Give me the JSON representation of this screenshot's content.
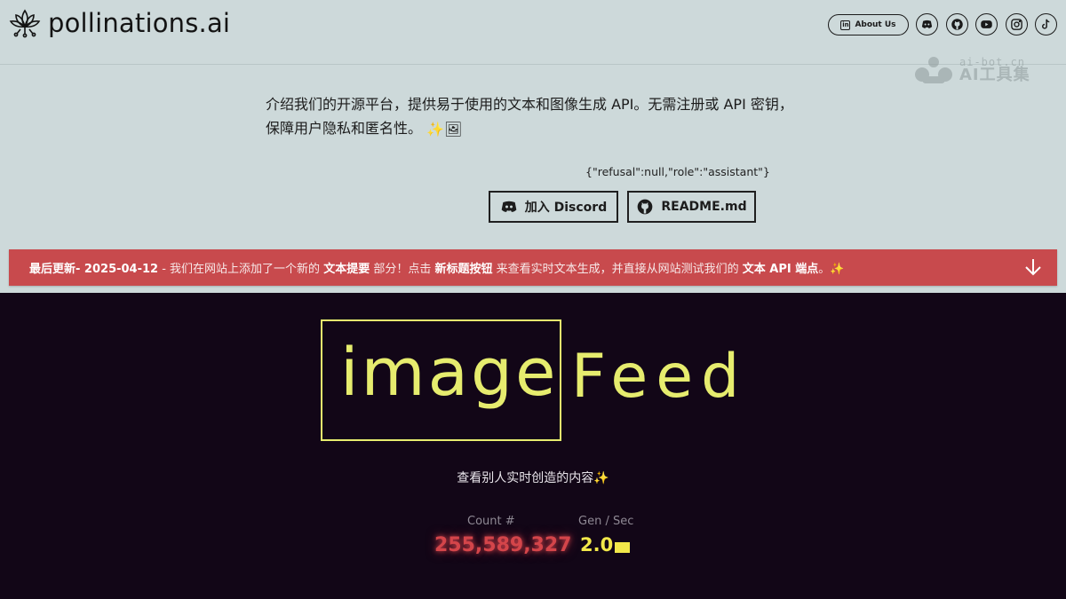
{
  "header": {
    "brand": "pollinations.ai",
    "about_label": "About Us",
    "linkedin_badge": "in",
    "social_icons": [
      "discord-icon",
      "github-icon",
      "youtube-icon",
      "instagram-icon",
      "tiktok-icon"
    ]
  },
  "watermark": {
    "top": "ai-bot.cn",
    "bottom": "AI工具集"
  },
  "intro": {
    "text": "介绍我们的开源平台，提供易于使用的文本和图像生成 API。无需注册或 API 密钥，保障用户隐私和匿名性。",
    "emoji": "✨🖼"
  },
  "raw_response": "{\"refusal\":null,\"role\":\"assistant\"}",
  "buttons": {
    "discord_label": "加入 Discord",
    "readme_label": "README.md"
  },
  "banner": {
    "part1": "最后更新",
    "part2": "- 2025-04-12",
    "part3": " - 我们在网站上添加了一个新的 ",
    "part4": "文本提要",
    "part5": " 部分！点击 ",
    "part6": "新标题按钮",
    "part7": " 来查看实时文本生成，并直接从网站测试我们的 ",
    "part8": "文本 API 端点",
    "part9": "。✨"
  },
  "feed": {
    "title_word1": "image",
    "title_word2": "Feed",
    "subtitle": "查看别人实时创造的内容✨",
    "count_label": "Count #",
    "count_value": "255,589,327",
    "gen_label": "Gen / Sec",
    "gen_value": "2.0"
  },
  "colors": {
    "top_bg": "#cdd9da",
    "banner_bg": "#c84a4d",
    "dark_bg": "#120617",
    "accent_yellow": "#e6ec6e",
    "count_red": "#d4454a"
  }
}
